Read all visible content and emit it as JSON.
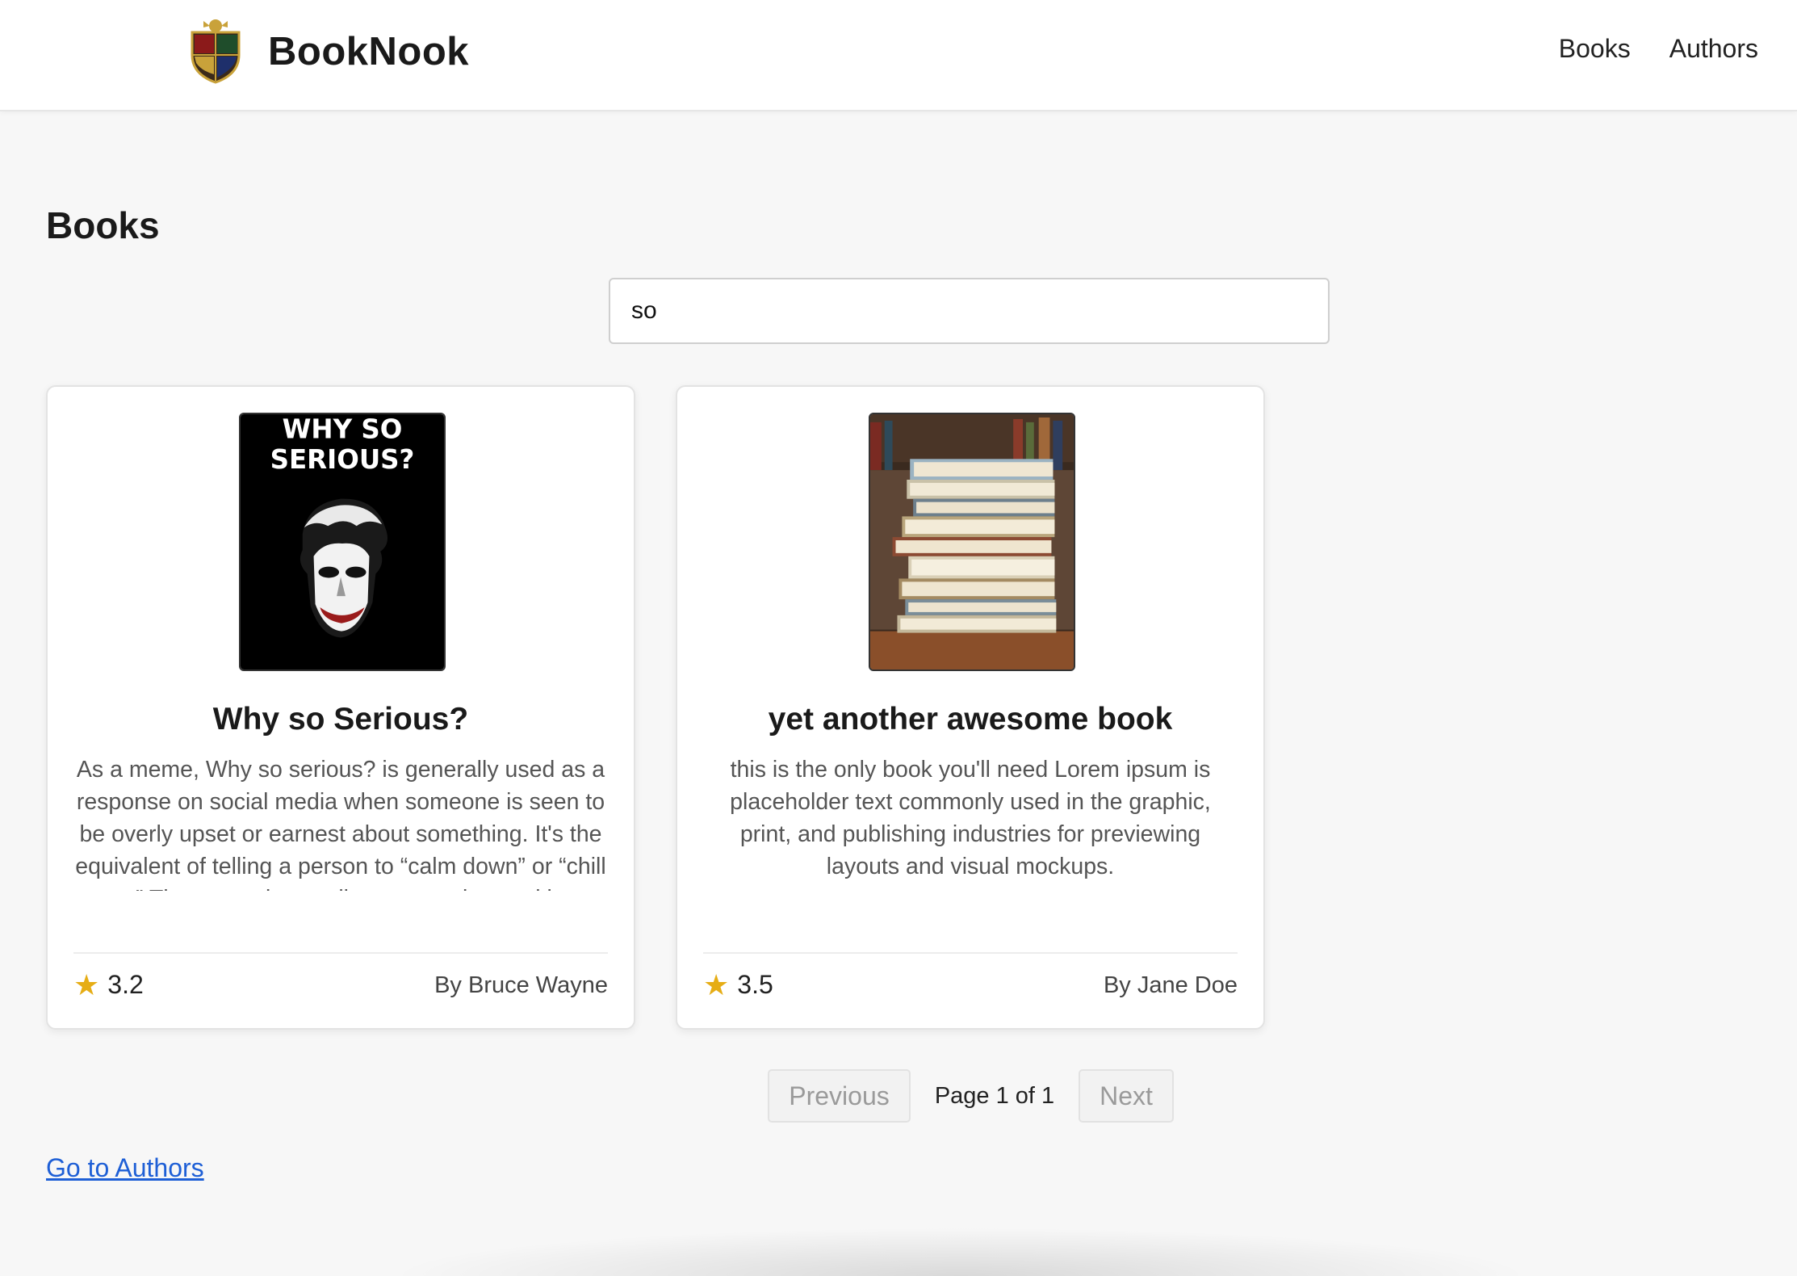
{
  "header": {
    "brand_name": "BookNook",
    "nav": [
      {
        "label": "Books"
      },
      {
        "label": "Authors"
      }
    ]
  },
  "main": {
    "page_title": "Books",
    "search": {
      "value": "so"
    },
    "books": [
      {
        "title": "Why so Serious?",
        "cover_text_line1": "WHY SO",
        "cover_text_line2": "SERIOUS?",
        "description": "As a meme, Why so serious? is generally used as a response on social media when someone is seen to be overly upset or earnest about something. It's the equivalent of telling a person to “calm down” or “chill out.” The meme is usually meant to be read in a",
        "rating": "3.2",
        "author": "By Bruce Wayne"
      },
      {
        "title": "yet another awesome book",
        "description": "this is the only book you'll need Lorem ipsum is placeholder text commonly used in the graphic, print, and publishing industries for previewing layouts and visual mockups.",
        "rating": "3.5",
        "author": "By Jane Doe"
      }
    ],
    "pagination": {
      "previous_label": "Previous",
      "page_info": "Page 1 of 1",
      "next_label": "Next"
    },
    "go_to_authors_label": "Go to Authors"
  },
  "colors": {
    "star": "#e6ad15",
    "link": "#1e5fd6",
    "disabled_text": "#9a9a9a"
  },
  "icons": {
    "rating": "star-icon",
    "logo": "crest-logo-icon"
  }
}
